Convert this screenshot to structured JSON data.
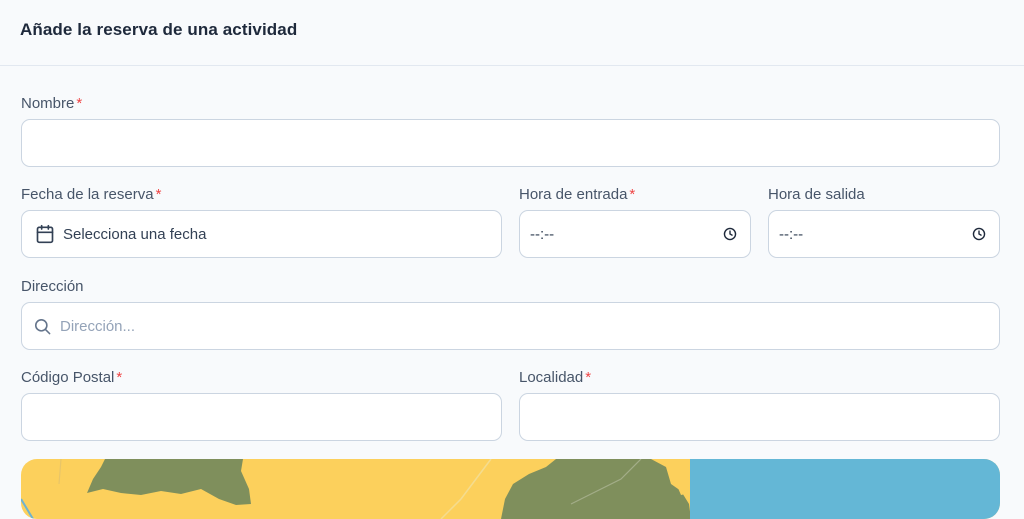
{
  "header": {
    "title": "Añade la reserva de una actividad"
  },
  "required_mark": "*",
  "form": {
    "nombre": {
      "label": "Nombre",
      "value": ""
    },
    "fecha": {
      "label": "Fecha de la reserva",
      "placeholder": "Selecciona una fecha",
      "icon": "calendar-icon"
    },
    "hora_entrada": {
      "label": "Hora de entrada",
      "value": "--:--",
      "icon": "clock-icon"
    },
    "hora_salida": {
      "label": "Hora de salida",
      "value": "--:--",
      "icon": "clock-icon"
    },
    "direccion": {
      "label": "Dirección",
      "placeholder": "Dirección...",
      "icon": "search-icon"
    },
    "codigo_postal": {
      "label": "Código Postal",
      "value": ""
    },
    "localidad": {
      "label": "Localidad",
      "value": ""
    }
  },
  "map": {
    "colors": {
      "land": "#fcd05c",
      "forest": "#7f8f5c",
      "water": "#64b7d6"
    }
  }
}
